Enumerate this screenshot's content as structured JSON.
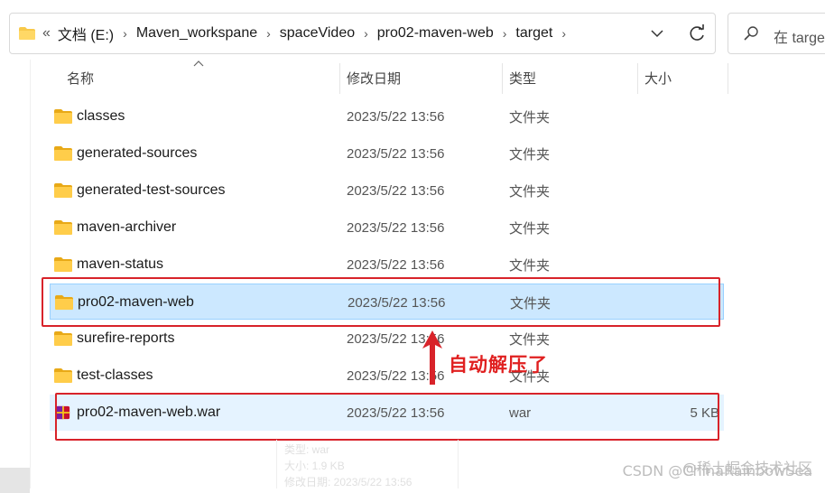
{
  "address_bar": {
    "overflow": "«",
    "crumbs": [
      "文档 (E:)",
      "Maven_workspane",
      "spaceVideo",
      "pro02-maven-web",
      "target"
    ],
    "separator": "›"
  },
  "search": {
    "placeholder": "在 targe"
  },
  "columns": {
    "name": "名称",
    "date": "修改日期",
    "type": "类型",
    "size": "大小"
  },
  "rows": [
    {
      "name": "classes",
      "date": "2023/5/22 13:56",
      "type": "文件夹",
      "size": "",
      "icon": "folder-icon"
    },
    {
      "name": "generated-sources",
      "date": "2023/5/22 13:56",
      "type": "文件夹",
      "size": "",
      "icon": "folder-icon"
    },
    {
      "name": "generated-test-sources",
      "date": "2023/5/22 13:56",
      "type": "文件夹",
      "size": "",
      "icon": "folder-icon"
    },
    {
      "name": "maven-archiver",
      "date": "2023/5/22 13:56",
      "type": "文件夹",
      "size": "",
      "icon": "folder-icon"
    },
    {
      "name": "maven-status",
      "date": "2023/5/22 13:56",
      "type": "文件夹",
      "size": "",
      "icon": "folder-icon"
    },
    {
      "name": "pro02-maven-web",
      "date": "2023/5/22 13:56",
      "type": "文件夹",
      "size": "",
      "icon": "folder-icon",
      "state": "selected"
    },
    {
      "name": "surefire-reports",
      "date": "2023/5/22 13:56",
      "type": "文件夹",
      "size": "",
      "icon": "folder-icon"
    },
    {
      "name": "test-classes",
      "date": "2023/5/22 13:56",
      "type": "文件夹",
      "size": "",
      "icon": "folder-icon"
    },
    {
      "name": "pro02-maven-web.war",
      "date": "2023/5/22 13:56",
      "type": "war",
      "size": "5 KB",
      "icon": "war-archive-icon",
      "state": "hover"
    }
  ],
  "annotation": {
    "text": "自动解压了",
    "color": "#e02020"
  },
  "ghost_tooltip": [
    "类型: war",
    "大小: 1.9 KB",
    "修改日期: 2023/5/22 13:56"
  ],
  "watermark": "CSDN @ChinaRainbowSea",
  "watermark_platform": "@稀土掘金技术社区",
  "colors": {
    "selected_bg": "#cce8ff",
    "hover_bg": "#e5f3ff",
    "folder": "#f8c94a",
    "annotation_red": "#d8232a"
  }
}
